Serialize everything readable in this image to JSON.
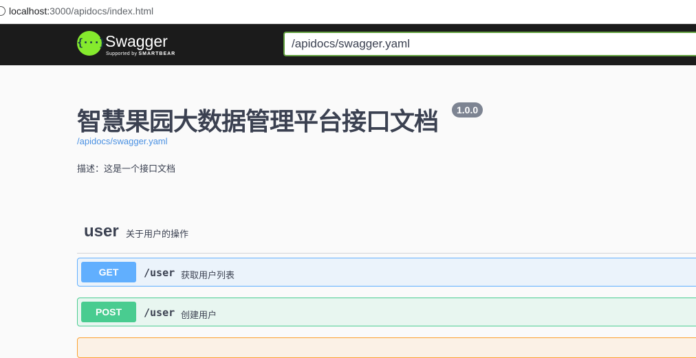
{
  "address_bar": {
    "host": "localhost:",
    "path": "3000/apidocs/index.html"
  },
  "topbar": {
    "logo_symbol": "{···}",
    "logo_title": "Swagger",
    "logo_supported_by": "Supported by",
    "logo_smartbear": "SMARTBEAR",
    "spec_url_value": "/apidocs/swagger.yaml"
  },
  "info": {
    "title": "智慧果园大数据管理平台接口文档",
    "version": "1.0.0",
    "spec_link": "/apidocs/swagger.yaml",
    "description": "描述：这是一个接口文档"
  },
  "tag": {
    "name": "user",
    "description": "关于用户的操作"
  },
  "operations": [
    {
      "method": "GET",
      "path": "/user",
      "summary": "获取用户列表"
    },
    {
      "method": "POST",
      "path": "/user",
      "summary": "创建用户"
    }
  ],
  "colors": {
    "get": "#61affe",
    "post": "#49cc90",
    "put": "#fca130",
    "swagger_green": "#85ea2d",
    "topbar_bg": "#1b1b1b"
  }
}
